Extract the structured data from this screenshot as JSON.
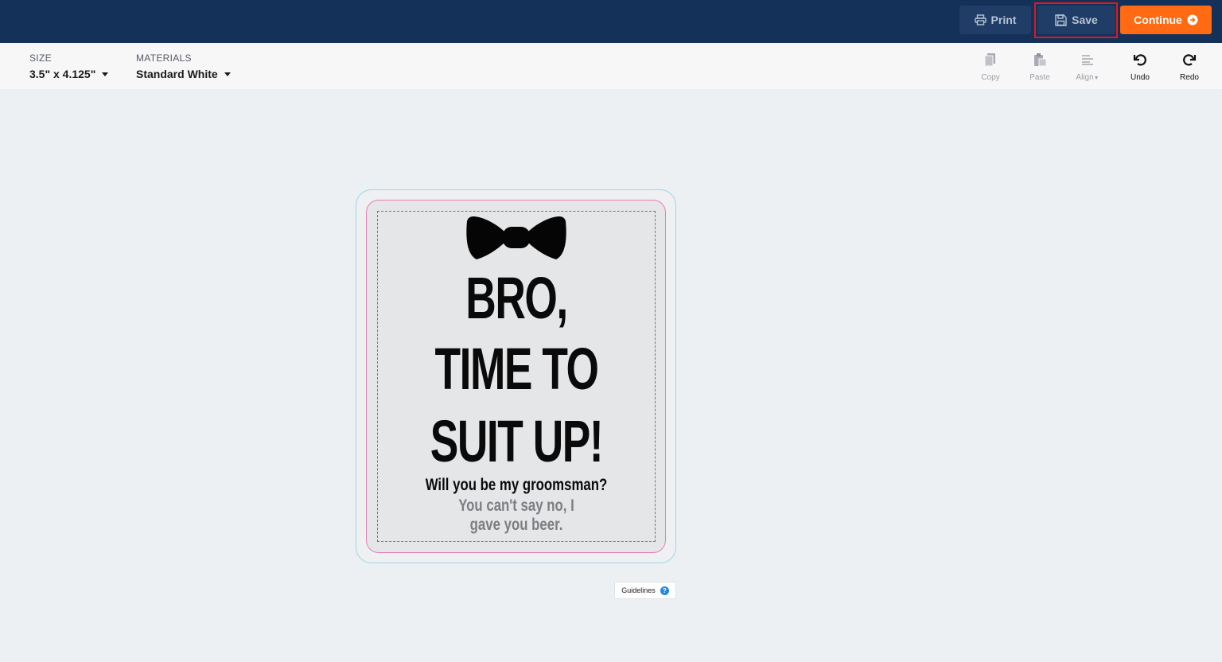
{
  "header": {
    "print_label": "Print",
    "save_label": "Save",
    "continue_label": "Continue"
  },
  "toolbar": {
    "size": {
      "label": "SIZE",
      "value": "3.5\" x 4.125\""
    },
    "materials": {
      "label": "MATERIALS",
      "value": "Standard White"
    },
    "tools": {
      "copy": "Copy",
      "paste": "Paste",
      "align": "Align",
      "undo": "Undo",
      "redo": "Redo"
    }
  },
  "design": {
    "line1": "BRO,",
    "line2": "TIME TO",
    "line3": "SUIT UP!",
    "sub1": "Will you be my groomsman?",
    "sub2": "You can't say no, I gave you beer."
  },
  "guidelines_label": "Guidelines",
  "colors": {
    "header_bg": "#143159",
    "continue_bg": "#ff6a13",
    "bleed_line": "#9fd6ea",
    "trim_line": "#e87fb5",
    "highlight": "#e01820"
  }
}
